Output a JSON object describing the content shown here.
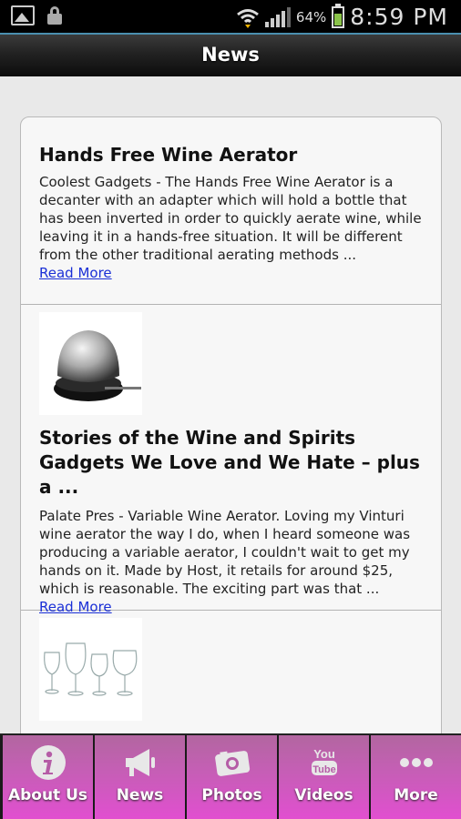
{
  "status_bar": {
    "battery_percent": "64%",
    "time": "8:59 PM"
  },
  "header": {
    "title": "News"
  },
  "articles": [
    {
      "title": "Hands Free Wine Aerator",
      "body": "Coolest Gadgets - The Hands Free Wine Aerator is a decanter with an adapter which will hold a bottle that has been inverted in order to quickly aerate wine, while leaving it in a hands-free situation. It will be different from the other traditional aerating methods ...",
      "link": "Read More"
    },
    {
      "title": "Stories of the Wine and Spirits Gadgets We Love and We Hate – plus a ...",
      "body": "Palate Pres - Variable Wine Aerator. Loving my Vinturi wine aerator the way I do, when I heard someone was producing a variable aerator, I couldn't wait to get my hands on it. Made by Host, it retails for around $25, which is reasonable. The exciting part was that ...",
      "link": "Read More"
    }
  ],
  "bottom_nav": [
    {
      "label": "About Us",
      "icon": "info-icon"
    },
    {
      "label": "News",
      "icon": "megaphone-icon"
    },
    {
      "label": "Photos",
      "icon": "camera-icon"
    },
    {
      "label": "Videos",
      "icon": "youtube-icon"
    },
    {
      "label": "More",
      "icon": "more-dots-icon"
    }
  ],
  "colors": {
    "nav_gradient_top": "#b266a0",
    "nav_gradient_bottom": "#e14fd0",
    "link": "#1a2fd6",
    "header_accent": "#4a8fb0"
  }
}
